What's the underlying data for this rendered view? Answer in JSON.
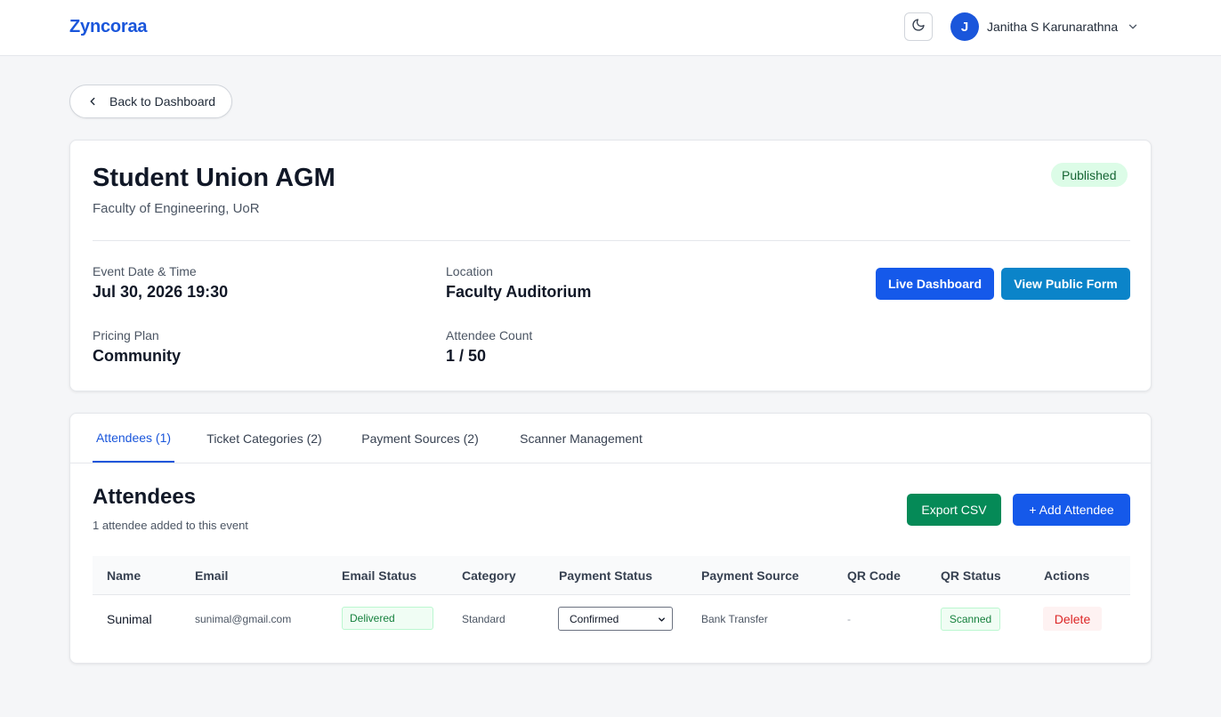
{
  "header": {
    "brand": "Zyncoraa",
    "user": {
      "initial": "J",
      "name": "Janitha S Karunarathna"
    }
  },
  "back_label": "Back to Dashboard",
  "event": {
    "title": "Student Union AGM",
    "organizer": "Faculty of Engineering, UoR",
    "status": "Published",
    "fields": {
      "date": {
        "label": "Event Date & Time",
        "value": "Jul 30, 2026 19:30"
      },
      "location": {
        "label": "Location",
        "value": "Faculty Auditorium"
      },
      "plan": {
        "label": "Pricing Plan",
        "value": "Community"
      },
      "count": {
        "label": "Attendee Count",
        "value": "1 / 50"
      }
    },
    "buttons": {
      "live": "Live Dashboard",
      "public_form": "View Public Form"
    }
  },
  "tabs": [
    {
      "label": "Attendees (1)",
      "active": true
    },
    {
      "label": "Ticket Categories (2)",
      "active": false
    },
    {
      "label": "Payment Sources (2)",
      "active": false
    },
    {
      "label": "Scanner Management",
      "active": false
    }
  ],
  "attendees": {
    "title": "Attendees",
    "subtitle": "1 attendee added to this event",
    "export_label": "Export CSV",
    "add_label": "+ Add Attendee",
    "columns": [
      "Name",
      "Email",
      "Email Status",
      "Category",
      "Payment Status",
      "Payment Source",
      "QR Code",
      "QR Status",
      "Actions"
    ],
    "rows": [
      {
        "name": "Sunimal",
        "email": "sunimal@gmail.com",
        "email_status": "Delivered",
        "category": "Standard",
        "payment_status": "Confirmed",
        "payment_source": "Bank Transfer",
        "qr_code": "-",
        "qr_status": "Scanned",
        "action": "Delete"
      }
    ]
  },
  "colors": {
    "primary": "#1559ea",
    "secondary": "#0b84c9",
    "success": "#058a57",
    "danger": "#dc2626"
  }
}
